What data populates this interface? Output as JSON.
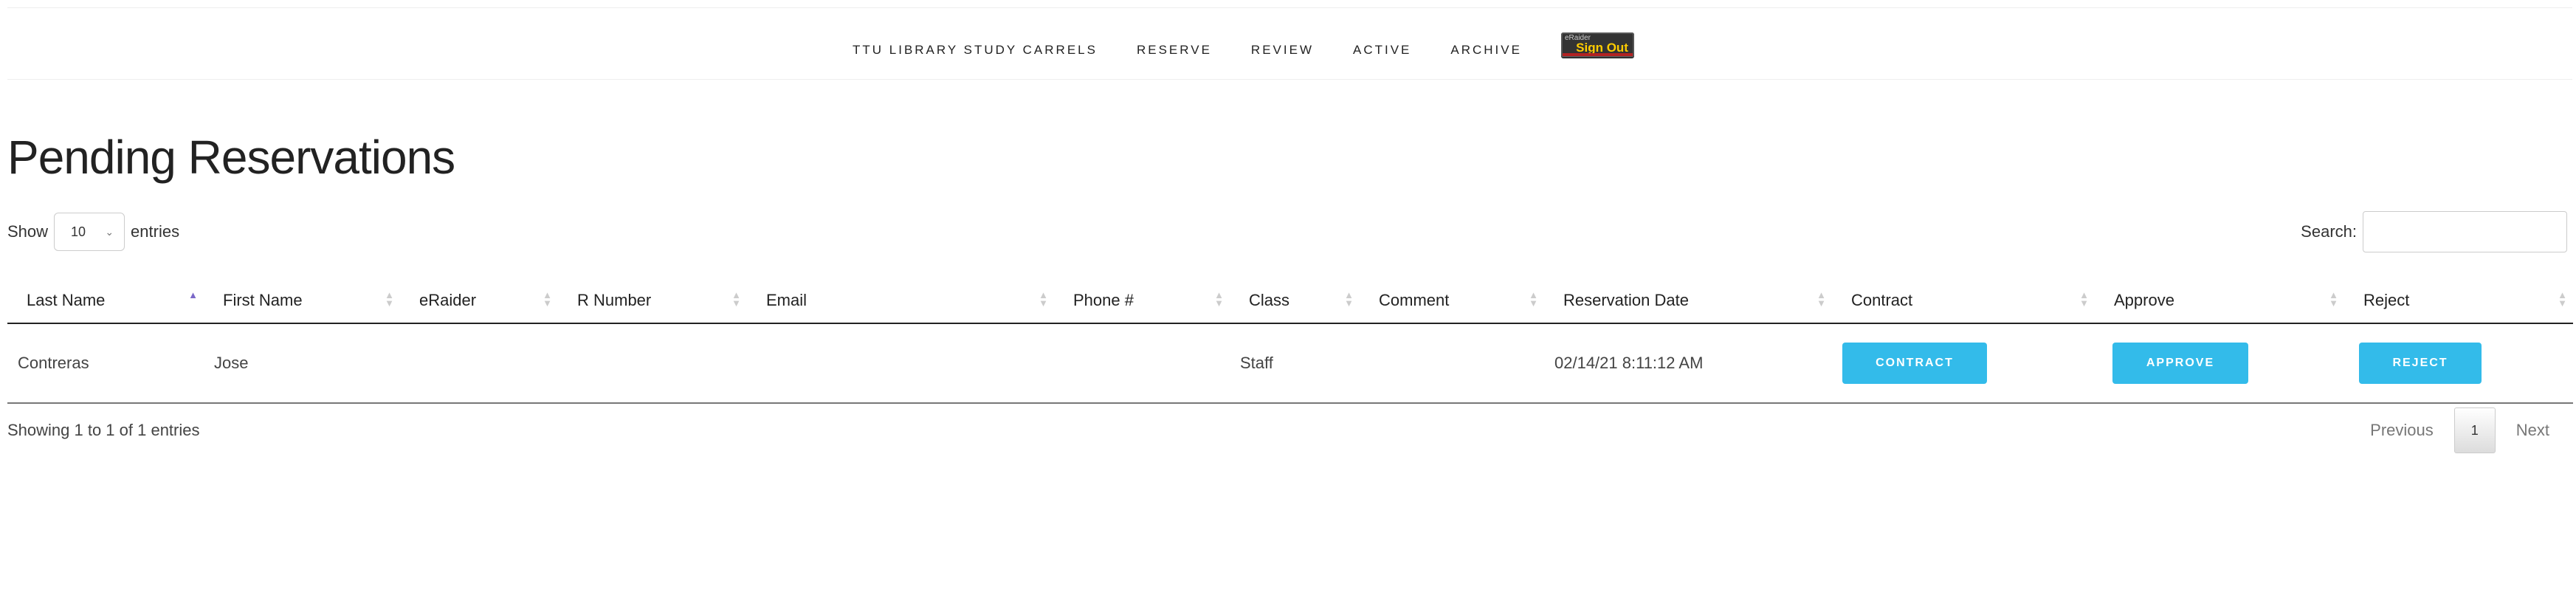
{
  "nav": {
    "items": [
      "TTU LIBRARY STUDY CARRELS",
      "RESERVE",
      "REVIEW",
      "ACTIVE",
      "ARCHIVE"
    ],
    "signout_small": "eRaider",
    "signout_label": "Sign Out"
  },
  "page_title": "Pending Reservations",
  "length": {
    "show_label": "Show",
    "value": "10",
    "entries_label": "entries"
  },
  "search": {
    "label": "Search:",
    "value": ""
  },
  "table": {
    "headers": [
      "Last Name",
      "First Name",
      "eRaider",
      "R Number",
      "Email",
      "Phone #",
      "Class",
      "Comment",
      "Reservation Date",
      "Contract",
      "Approve",
      "Reject"
    ],
    "rows": [
      {
        "last_name": "Contreras",
        "first_name": "Jose",
        "eraider": "",
        "r_number": "",
        "email": "",
        "phone": "",
        "class": "Staff",
        "comment": "",
        "reservation_date": "02/14/21 8:11:12 AM",
        "contract": "CONTRACT",
        "approve": "APPROVE",
        "reject": "REJECT"
      }
    ]
  },
  "info": "Showing 1 to 1 of 1 entries",
  "pagination": {
    "previous": "Previous",
    "current": "1",
    "next": "Next"
  },
  "colors": {
    "button": "#33bbea",
    "sort_active": "#7b68c8"
  }
}
